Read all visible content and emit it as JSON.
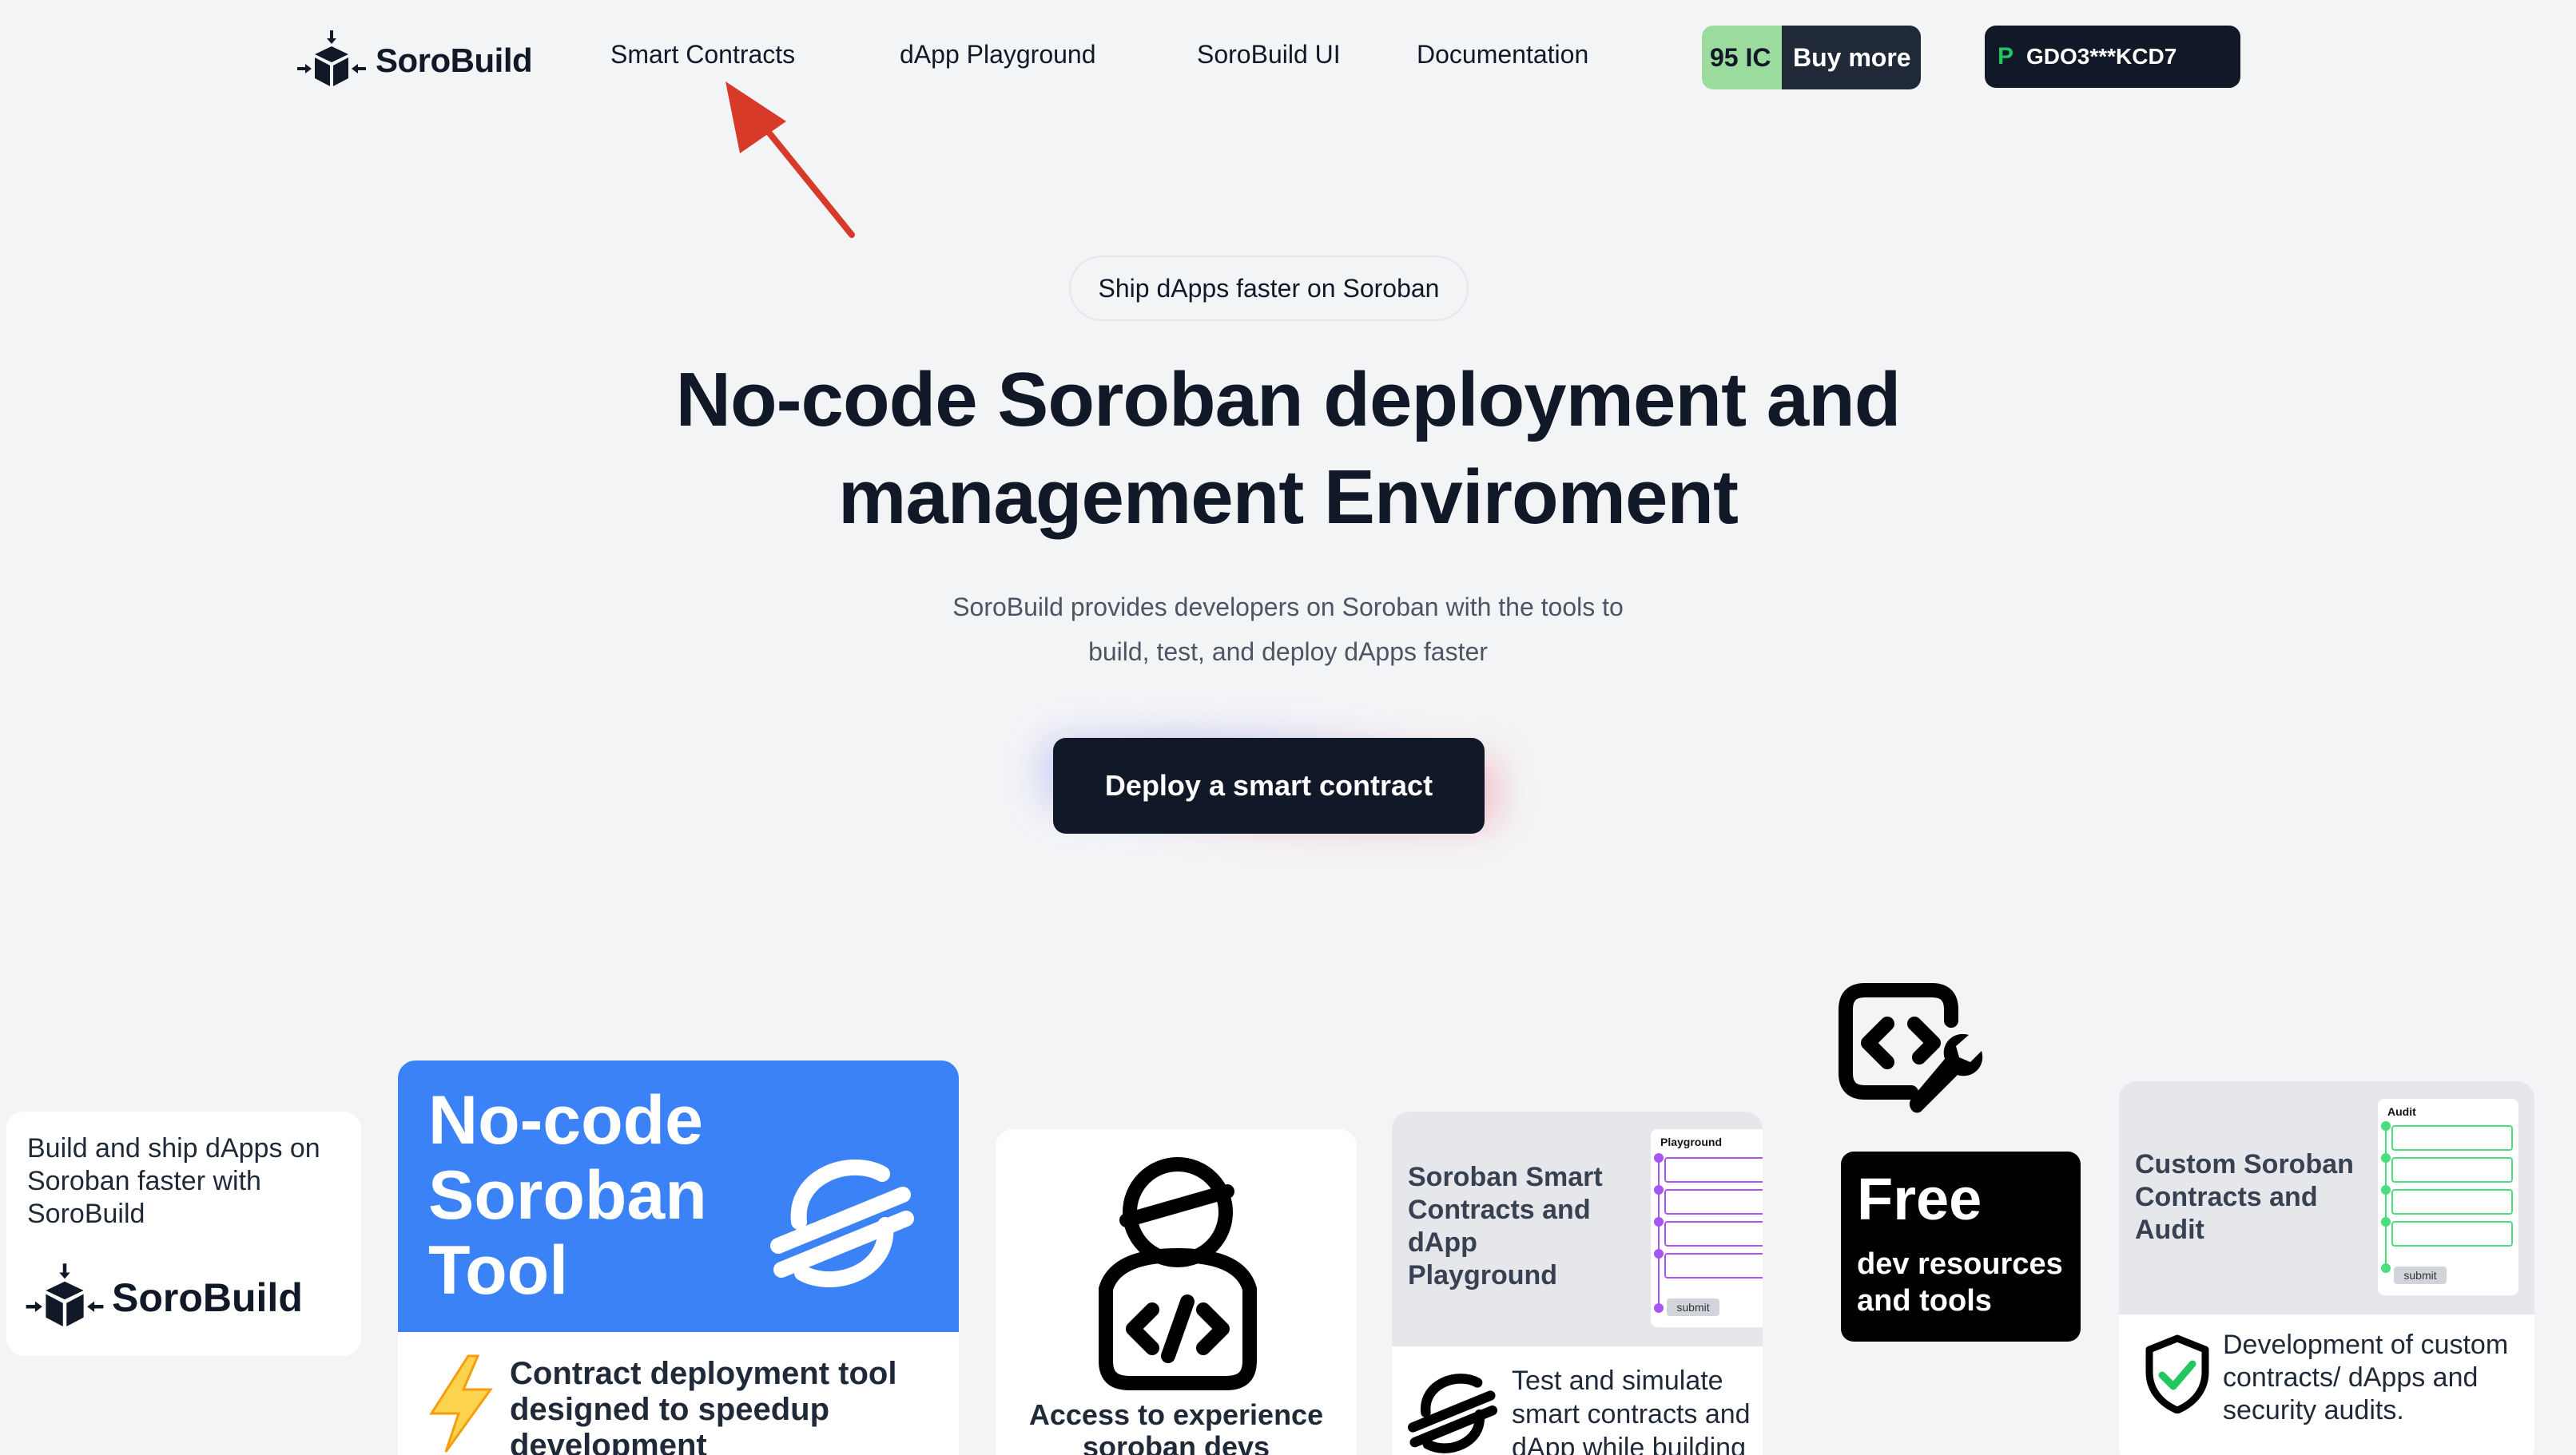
{
  "nav": {
    "logo_text": "SoroBuild",
    "links": [
      "Smart Contracts",
      "dApp Playground",
      "SoroBuild UI",
      "Documentation"
    ],
    "credits_amount": "95 IC",
    "buy_more": "Buy more",
    "wallet_prefix": "P",
    "wallet_address": "GDO3***KCD7"
  },
  "hero": {
    "pill": "Ship dApps faster on Soroban",
    "headline_line1": "No-code Soroban deployment and",
    "headline_line2": "management Enviroment",
    "sub_line1": "SoroBuild provides developers on Soroban with the tools to",
    "sub_line2": "build, test, and deploy dApps faster",
    "cta": "Deploy a smart contract"
  },
  "cards": {
    "intro": {
      "text": "Build and ship dApps on Soroban faster with SoroBuild",
      "brand": "SoroBuild"
    },
    "nocode": {
      "title_l1": "No-code",
      "title_l2": "Soroban",
      "title_l3": "Tool",
      "desc": "Contract deployment tool designed to speedup development"
    },
    "devs": {
      "desc": "Access to experience soroban devs"
    },
    "playground": {
      "title": "Soroban Smart Contracts and dApp Playground",
      "mock_label": "Playground",
      "mock_button": "submit",
      "desc": "Test and simulate smart contracts and dApp while building"
    },
    "free": {
      "title": "Free",
      "desc": "dev resources and tools"
    },
    "audit": {
      "title": "Custom Soroban Contracts and Audit",
      "mock_label": "Audit",
      "mock_button": "submit",
      "desc": "Development of custom contracts/ dApps and security audits."
    }
  },
  "colors": {
    "accent_blue": "#3b82f6",
    "dark": "#111827",
    "credit_green": "#9bdc9e",
    "annotation_red": "#d83a2a",
    "mock_purple": "#a855f7",
    "mock_green": "#4ade80"
  }
}
